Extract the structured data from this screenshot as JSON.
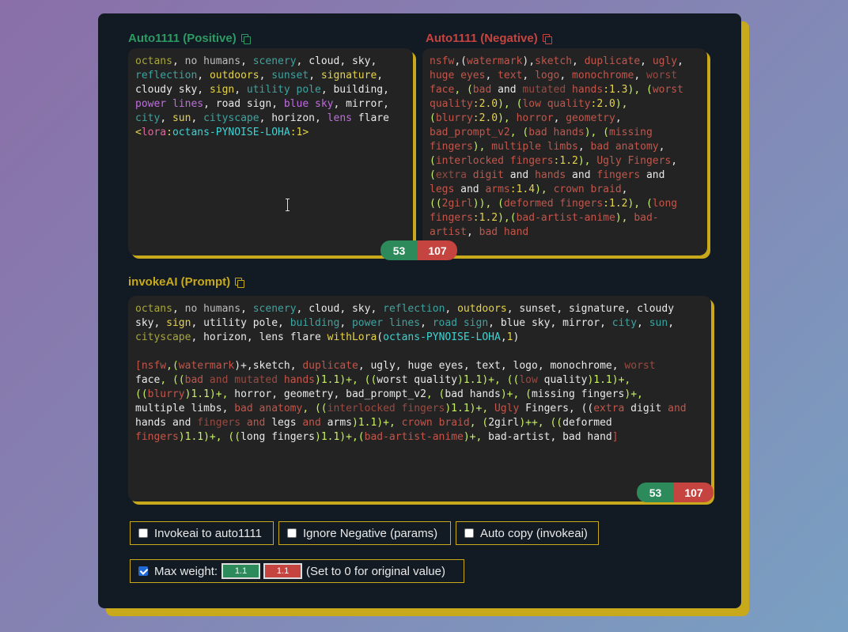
{
  "colors": {
    "accent": "#c8a91c",
    "panel": "#121a23",
    "positive": "#2d8a5a",
    "negative": "#c5443f"
  },
  "positive": {
    "title": "Auto1111 (Positive)",
    "copy_icon": "copy-icon",
    "tokens": [
      [
        "octans",
        "t-olive"
      ],
      [
        ", ",
        "t-white"
      ],
      [
        "no humans",
        "t-gray"
      ],
      [
        ", ",
        "t-white"
      ],
      [
        "scenery",
        "t-teal"
      ],
      [
        ", ",
        "t-white"
      ],
      [
        "cloud",
        "t-white"
      ],
      [
        ", ",
        "t-white"
      ],
      [
        "sky",
        "t-white"
      ],
      [
        ",\n",
        "t-white"
      ],
      [
        "reflection",
        "t-teal"
      ],
      [
        ", ",
        "t-white"
      ],
      [
        "outdoors",
        "t-yellow"
      ],
      [
        ", ",
        "t-white"
      ],
      [
        "sunset",
        "t-teal"
      ],
      [
        ", ",
        "t-white"
      ],
      [
        "signature",
        "t-yellow"
      ],
      [
        ",\n",
        "t-white"
      ],
      [
        "cloudy sky",
        "t-white"
      ],
      [
        ", ",
        "t-white"
      ],
      [
        "sign",
        "t-yellow"
      ],
      [
        ", ",
        "t-white"
      ],
      [
        "utility pole",
        "t-teal"
      ],
      [
        ", ",
        "t-white"
      ],
      [
        "building",
        "t-white"
      ],
      [
        ",\n",
        "t-white"
      ],
      [
        "power lines",
        "t-purple"
      ],
      [
        ", ",
        "t-white"
      ],
      [
        "road sign",
        "t-white"
      ],
      [
        ", ",
        "t-white"
      ],
      [
        "blue sky",
        "t-purple"
      ],
      [
        ", ",
        "t-white"
      ],
      [
        "mirror",
        "t-white"
      ],
      [
        ",\n",
        "t-white"
      ],
      [
        "city",
        "t-teal"
      ],
      [
        ", ",
        "t-white"
      ],
      [
        "sun",
        "t-yellow"
      ],
      [
        ", ",
        "t-white"
      ],
      [
        "cityscape",
        "t-teal"
      ],
      [
        ", ",
        "t-white"
      ],
      [
        "horizon",
        "t-white"
      ],
      [
        ", ",
        "t-white"
      ],
      [
        "lens",
        "t-purple"
      ],
      [
        " flare\n",
        "t-white"
      ],
      [
        "<",
        "t-yellow"
      ],
      [
        "lora",
        "t-pink"
      ],
      [
        ":",
        "t-yellow"
      ],
      [
        "octans-PYNOISE-LOHA",
        "t-cyan"
      ],
      [
        ":",
        "t-yellow"
      ],
      [
        "1",
        "t-yellow"
      ],
      [
        ">",
        "t-yellow"
      ]
    ]
  },
  "negative": {
    "title": "Auto1111 (Negative)",
    "copy_icon": "copy-icon",
    "tokens": [
      [
        "nsfw",
        "t-rose"
      ],
      [
        ",(",
        "t-white"
      ],
      [
        "watermark",
        "t-rose"
      ],
      [
        "),",
        "t-white"
      ],
      [
        "sketch",
        "t-rose"
      ],
      [
        ", ",
        "t-white"
      ],
      [
        "duplicate",
        "t-rose"
      ],
      [
        ", ",
        "t-white"
      ],
      [
        "ugly",
        "t-rose"
      ],
      [
        ",\n",
        "t-white"
      ],
      [
        "huge eyes",
        "t-rose"
      ],
      [
        ", ",
        "t-white"
      ],
      [
        "text",
        "t-rose"
      ],
      [
        ", ",
        "t-white"
      ],
      [
        "logo",
        "t-rose"
      ],
      [
        ", ",
        "t-white"
      ],
      [
        "monochrome",
        "t-rose"
      ],
      [
        ", ",
        "t-white"
      ],
      [
        "worst",
        "t-dim"
      ],
      [
        "\n",
        "t-white"
      ],
      [
        "face",
        "t-rose"
      ],
      [
        ", (",
        "t-lime"
      ],
      [
        "bad",
        "t-rose"
      ],
      [
        " and ",
        "t-white"
      ],
      [
        "mutated",
        "t-dim"
      ],
      [
        " hands",
        "t-rose"
      ],
      [
        ":1.3",
        "t-yellow"
      ],
      [
        "), (",
        "t-lime"
      ],
      [
        "worst",
        "t-rose"
      ],
      [
        "\n",
        "t-white"
      ],
      [
        "quality",
        "t-rose"
      ],
      [
        ":2.0",
        "t-yellow"
      ],
      [
        "), (",
        "t-lime"
      ],
      [
        "low quality",
        "t-rose"
      ],
      [
        ":2.0",
        "t-yellow"
      ],
      [
        "),\n",
        "t-lime"
      ],
      [
        "(",
        "t-lime"
      ],
      [
        "blurry",
        "t-rose"
      ],
      [
        ":2.0",
        "t-yellow"
      ],
      [
        "), ",
        "t-lime"
      ],
      [
        "horror",
        "t-rose"
      ],
      [
        ", ",
        "t-white"
      ],
      [
        "geometry",
        "t-rose"
      ],
      [
        ",\n",
        "t-white"
      ],
      [
        "bad_prompt_v2",
        "t-rose"
      ],
      [
        ", (",
        "t-lime"
      ],
      [
        "bad hands",
        "t-rose"
      ],
      [
        "), (",
        "t-lime"
      ],
      [
        "missing",
        "t-rose"
      ],
      [
        "\n",
        "t-white"
      ],
      [
        "fingers",
        "t-rose"
      ],
      [
        "), ",
        "t-lime"
      ],
      [
        "multiple limbs",
        "t-rose"
      ],
      [
        ", ",
        "t-white"
      ],
      [
        "bad anatomy",
        "t-rose"
      ],
      [
        ",\n",
        "t-white"
      ],
      [
        "(",
        "t-lime"
      ],
      [
        "interlocked fingers",
        "t-rose"
      ],
      [
        ":1.2",
        "t-yellow"
      ],
      [
        "), ",
        "t-lime"
      ],
      [
        "Ugly Fingers",
        "t-rose"
      ],
      [
        ",\n",
        "t-white"
      ],
      [
        "(",
        "t-lime"
      ],
      [
        "extra",
        "t-dim"
      ],
      [
        " digit ",
        "t-rose"
      ],
      [
        "and",
        "t-white"
      ],
      [
        " hands ",
        "t-rose"
      ],
      [
        "and",
        "t-white"
      ],
      [
        " fingers ",
        "t-rose"
      ],
      [
        "and",
        "t-white"
      ],
      [
        "\n",
        "t-white"
      ],
      [
        "legs ",
        "t-rose"
      ],
      [
        "and",
        "t-white"
      ],
      [
        " arms",
        "t-rose"
      ],
      [
        ":1.4",
        "t-yellow"
      ],
      [
        "), ",
        "t-lime"
      ],
      [
        "crown braid",
        "t-rose"
      ],
      [
        ",\n",
        "t-white"
      ],
      [
        "((",
        "t-lime"
      ],
      [
        "2girl",
        "t-rose"
      ],
      [
        ")), (",
        "t-lime"
      ],
      [
        "deformed fingers",
        "t-rose"
      ],
      [
        ":1.2",
        "t-yellow"
      ],
      [
        "), (",
        "t-lime"
      ],
      [
        "long",
        "t-rose"
      ],
      [
        "\n",
        "t-white"
      ],
      [
        "fingers",
        "t-rose"
      ],
      [
        ":1.2",
        "t-yellow"
      ],
      [
        "),(",
        "t-lime"
      ],
      [
        "bad-artist-anime",
        "t-rose"
      ],
      [
        "), ",
        "t-lime"
      ],
      [
        "bad-",
        "t-rose"
      ],
      [
        "\n",
        "t-white"
      ],
      [
        "artist",
        "t-rose"
      ],
      [
        ", ",
        "t-white"
      ],
      [
        "bad hand",
        "t-rose"
      ]
    ]
  },
  "top_counts": {
    "positive": "53",
    "negative": "107"
  },
  "invoke": {
    "title": "invokeAI (Prompt)",
    "copy_icon": "copy-icon",
    "tokens": [
      [
        "octans",
        "t-olive"
      ],
      [
        ", ",
        "t-white"
      ],
      [
        "no humans",
        "t-gray"
      ],
      [
        ", ",
        "t-white"
      ],
      [
        "scenery",
        "t-teal"
      ],
      [
        ", ",
        "t-white"
      ],
      [
        "cloud",
        "t-white"
      ],
      [
        ", ",
        "t-white"
      ],
      [
        "sky",
        "t-white"
      ],
      [
        ", ",
        "t-white"
      ],
      [
        "reflection",
        "t-teal"
      ],
      [
        ", ",
        "t-white"
      ],
      [
        "outdoors",
        "t-yellow"
      ],
      [
        ", ",
        "t-white"
      ],
      [
        "sunset",
        "t-white"
      ],
      [
        ", ",
        "t-white"
      ],
      [
        "signature",
        "t-white"
      ],
      [
        ", ",
        "t-white"
      ],
      [
        "cloudy",
        "t-white"
      ],
      [
        "\n",
        "t-white"
      ],
      [
        "sky",
        "t-white"
      ],
      [
        ", ",
        "t-white"
      ],
      [
        "sign",
        "t-yellow"
      ],
      [
        ", ",
        "t-white"
      ],
      [
        "utility pole",
        "t-white"
      ],
      [
        ", ",
        "t-white"
      ],
      [
        "building",
        "t-teal"
      ],
      [
        ", ",
        "t-white"
      ],
      [
        "power lines",
        "t-teal"
      ],
      [
        ", ",
        "t-white"
      ],
      [
        "road sign",
        "t-teal"
      ],
      [
        ", ",
        "t-white"
      ],
      [
        "blue sky",
        "t-white"
      ],
      [
        ", ",
        "t-white"
      ],
      [
        "mirror",
        "t-white"
      ],
      [
        ", ",
        "t-white"
      ],
      [
        "city",
        "t-teal"
      ],
      [
        ", ",
        "t-white"
      ],
      [
        "sun",
        "t-teal"
      ],
      [
        ",\n",
        "t-white"
      ],
      [
        "cityscape",
        "t-olive"
      ],
      [
        ", ",
        "t-white"
      ],
      [
        "horizon",
        "t-white"
      ],
      [
        ", ",
        "t-white"
      ],
      [
        "lens",
        "t-white"
      ],
      [
        " flare ",
        "t-white"
      ],
      [
        "withLora",
        "t-yellow"
      ],
      [
        "(",
        "t-white"
      ],
      [
        "octans-PYNOISE-LOHA",
        "t-cyan"
      ],
      [
        ",",
        "t-white"
      ],
      [
        "1",
        "t-yellow"
      ],
      [
        ")\n\n",
        "t-white"
      ],
      [
        "[",
        "t-rose"
      ],
      [
        "nsfw",
        "t-rose"
      ],
      [
        ",(",
        "t-lime"
      ],
      [
        "watermark",
        "t-rose"
      ],
      [
        ")+,",
        "t-white"
      ],
      [
        "sketch",
        "t-white"
      ],
      [
        ", ",
        "t-white"
      ],
      [
        "duplicate",
        "t-rose"
      ],
      [
        ", ",
        "t-white"
      ],
      [
        "ugly",
        "t-white"
      ],
      [
        ", ",
        "t-white"
      ],
      [
        "huge eyes",
        "t-white"
      ],
      [
        ", ",
        "t-white"
      ],
      [
        "text",
        "t-white"
      ],
      [
        ", ",
        "t-white"
      ],
      [
        "logo",
        "t-white"
      ],
      [
        ", ",
        "t-white"
      ],
      [
        "monochrome",
        "t-white"
      ],
      [
        ", ",
        "t-white"
      ],
      [
        "worst",
        "t-dim"
      ],
      [
        "\n",
        "t-white"
      ],
      [
        "face",
        "t-white"
      ],
      [
        ", ((",
        "t-lime"
      ],
      [
        "bad",
        "t-rose"
      ],
      [
        " and ",
        "t-dim"
      ],
      [
        "mutated",
        "t-dim"
      ],
      [
        " hands",
        "t-rose"
      ],
      [
        ")1.1)+, ((",
        "t-lime"
      ],
      [
        "worst quality",
        "t-white"
      ],
      [
        ")1.1)+, ((",
        "t-lime"
      ],
      [
        "low",
        "t-dim"
      ],
      [
        " quality",
        "t-white"
      ],
      [
        ")1.1)+,\n",
        "t-lime"
      ],
      [
        "((",
        "t-lime"
      ],
      [
        "blurry",
        "t-rose"
      ],
      [
        ")1.1)+, ",
        "t-lime"
      ],
      [
        "horror",
        "t-white"
      ],
      [
        ", ",
        "t-white"
      ],
      [
        "geometry",
        "t-white"
      ],
      [
        ", ",
        "t-white"
      ],
      [
        "bad_prompt_v2",
        "t-white"
      ],
      [
        ", (",
        "t-lime"
      ],
      [
        "bad hands",
        "t-white"
      ],
      [
        ")+, (",
        "t-lime"
      ],
      [
        "missing fingers",
        "t-white"
      ],
      [
        ")+,\n",
        "t-lime"
      ],
      [
        "multiple limbs",
        "t-white"
      ],
      [
        ", ",
        "t-white"
      ],
      [
        "bad anatomy",
        "t-rose"
      ],
      [
        ", ((",
        "t-lime"
      ],
      [
        "interlocked",
        "t-dim"
      ],
      [
        " fingers",
        "t-dim"
      ],
      [
        ")1.1)+, ",
        "t-lime"
      ],
      [
        "Ugly",
        "t-rose"
      ],
      [
        " Fingers, ((",
        "t-white"
      ],
      [
        "extra",
        "t-rose"
      ],
      [
        " digit ",
        "t-white"
      ],
      [
        "and",
        "t-rose"
      ],
      [
        "\n",
        "t-white"
      ],
      [
        "hands ",
        "t-white"
      ],
      [
        "and",
        "t-white"
      ],
      [
        " fingers ",
        "t-dim"
      ],
      [
        "and",
        "t-rose"
      ],
      [
        " legs ",
        "t-white"
      ],
      [
        "and",
        "t-rose"
      ],
      [
        " arms",
        "t-white"
      ],
      [
        ")1.1)+, ",
        "t-lime"
      ],
      [
        "crown braid",
        "t-rose"
      ],
      [
        ", (",
        "t-lime"
      ],
      [
        "2girl",
        "t-white"
      ],
      [
        ")++, ((",
        "t-lime"
      ],
      [
        "deformed",
        "t-white"
      ],
      [
        "\n",
        "t-white"
      ],
      [
        "fingers",
        "t-rose"
      ],
      [
        ")1.1)+, ((",
        "t-lime"
      ],
      [
        "long fingers",
        "t-white"
      ],
      [
        ")1.1)+,(",
        "t-lime"
      ],
      [
        "bad-artist-anime",
        "t-rose"
      ],
      [
        ")+, ",
        "t-lime"
      ],
      [
        "bad-artist",
        "t-white"
      ],
      [
        ", ",
        "t-white"
      ],
      [
        "bad hand",
        "t-white"
      ],
      [
        "]",
        "t-rose"
      ]
    ]
  },
  "bottom_counts": {
    "positive": "53",
    "negative": "107"
  },
  "options": {
    "invokeai_to_auto": {
      "label": "Invokeai to auto1111",
      "checked": false
    },
    "ignore_negative": {
      "label": "Ignore Negative (params)",
      "checked": false
    },
    "auto_copy": {
      "label": "Auto copy (invokeai)",
      "checked": false
    },
    "max_weight": {
      "label": "Max weight:",
      "checked": true,
      "positive_value": "1.1",
      "negative_value": "1.1",
      "hint": "(Set to 0 for original value)"
    }
  }
}
